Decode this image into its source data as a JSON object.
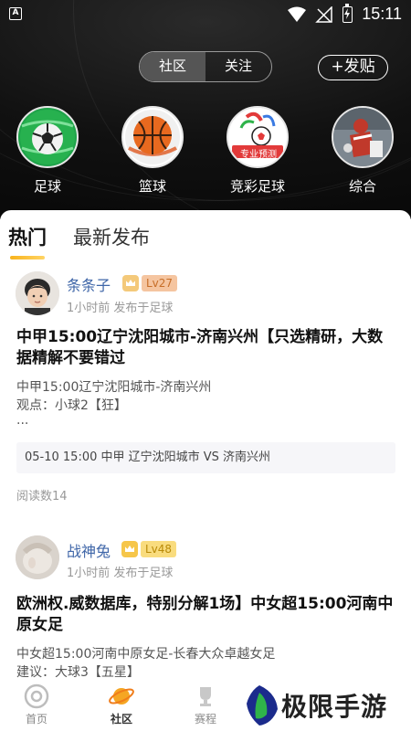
{
  "status_bar": {
    "app_letter": "A",
    "time": "15:11"
  },
  "segment": {
    "tabs": [
      "社区",
      "关注"
    ],
    "active": 0
  },
  "post_button": "+发贴",
  "categories": [
    {
      "label": "足球",
      "icon": "soccer-ball-icon"
    },
    {
      "label": "篮球",
      "icon": "basketball-icon"
    },
    {
      "label": "竞彩足球",
      "icon": "lottery-football-icon",
      "inner_text": "专业预测"
    },
    {
      "label": "综合",
      "icon": "general-sports-icon"
    }
  ],
  "feed_tabs": [
    "热门",
    "最新发布"
  ],
  "posts": [
    {
      "user": "条条子",
      "level": "Lv27",
      "level_color": "#f5b380",
      "meta": "1小时前 发布于足球",
      "title": "中甲15:00辽宁沈阳城市-济南兴州【只选精研，大数据精解不要错过",
      "excerpt_lines": [
        "中甲15:00辽宁沈阳城市-济南兴州",
        "观点：小球2【狂】",
        "..."
      ],
      "match": "05-10 15:00 中甲 辽宁沈阳城市 VS 济南兴州",
      "reads": "阅读数14"
    },
    {
      "user": "战神兔",
      "level": "Lv48",
      "level_color": "#f6c64a",
      "meta": "1小时前 发布于足球",
      "title": "欧洲权.威数据库，特别分解1场】中女超15:00河南中原女足",
      "excerpt_lines": [
        "中女超15:00河南中原女足-长春大众卓越女足",
        "建议：大球3【五星】"
      ]
    }
  ],
  "bottom_nav": [
    {
      "label": "首页",
      "icon": "home-icon"
    },
    {
      "label": "社区",
      "icon": "planet-icon"
    },
    {
      "label": "赛程",
      "icon": "trophy-icon"
    }
  ],
  "watermark": "极限手游网",
  "colors": {
    "accent": "#f8b31c",
    "username": "#3f66a8",
    "header_bg": "#111111"
  }
}
